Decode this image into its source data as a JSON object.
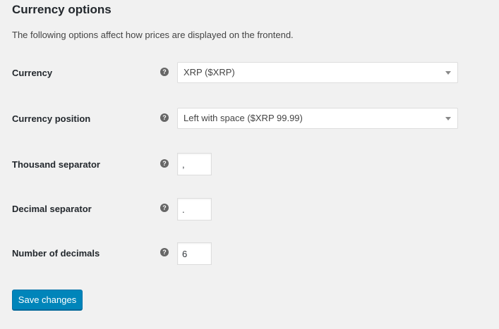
{
  "section": {
    "title": "Currency options",
    "description": "The following options affect how prices are displayed on the frontend."
  },
  "help_icon_glyph": "?",
  "fields": {
    "currency": {
      "label": "Currency",
      "value": "XRP ($XRP)"
    },
    "currency_position": {
      "label": "Currency position",
      "value": "Left with space ($XRP 99.99)"
    },
    "thousand_separator": {
      "label": "Thousand separator",
      "value": ","
    },
    "decimal_separator": {
      "label": "Decimal separator",
      "value": "."
    },
    "number_of_decimals": {
      "label": "Number of decimals",
      "value": "6"
    }
  },
  "actions": {
    "save_label": "Save changes"
  },
  "colors": {
    "background": "#f1f1f1",
    "primary_button": "#0085ba",
    "help_icon": "#666666"
  }
}
